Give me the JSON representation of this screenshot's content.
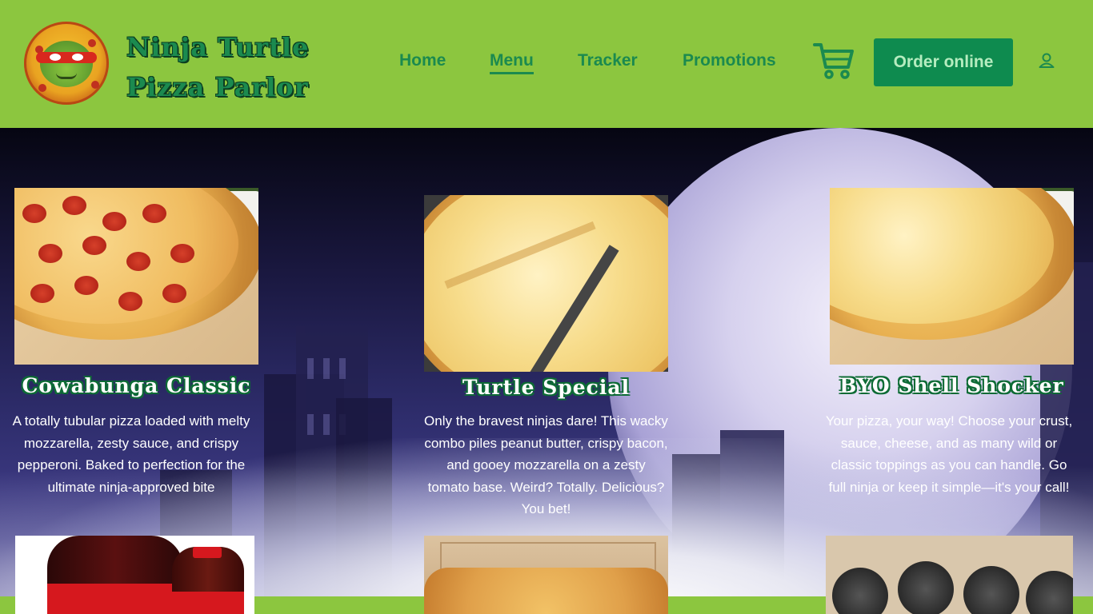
{
  "brand": {
    "line1": "Ninja Turtle",
    "line2": "Pizza Parlor"
  },
  "nav": {
    "links": [
      "Home",
      "Menu",
      "Tracker",
      "Promotions"
    ],
    "active": "Menu",
    "order_label": "Order online"
  },
  "icons": {
    "logo": "turtle-pizza-logo-icon",
    "cart": "cart-icon",
    "account": "account-icon"
  },
  "colors": {
    "header_bg": "#8cc63f",
    "nav_text": "#1b8a4f",
    "order_button_bg": "#0e8b4f",
    "order_button_text": "#b5ecbf",
    "title_outline": "#0d6b35"
  },
  "menu": {
    "items": [
      {
        "title": "Cowabunga Classic",
        "description": "A totally tubular pizza loaded with melty mozzarella, zesty sauce, and crispy pepperoni. Baked to perfection for the ultimate ninja-approved bite"
      },
      {
        "title": "Turtle Special",
        "description": "Only the bravest ninjas dare! This wacky combo piles peanut butter, crispy bacon, and gooey mozzarella on a zesty tomato base. Weird? Totally. Delicious? You bet!"
      },
      {
        "title": "BYO Shell Shocker",
        "description": "Your pizza, your way! Choose your crust, sauce, cheese, and as many wild or classic toppings as you can handle. Go full ninja or keep it simple—it's your call!"
      }
    ]
  }
}
